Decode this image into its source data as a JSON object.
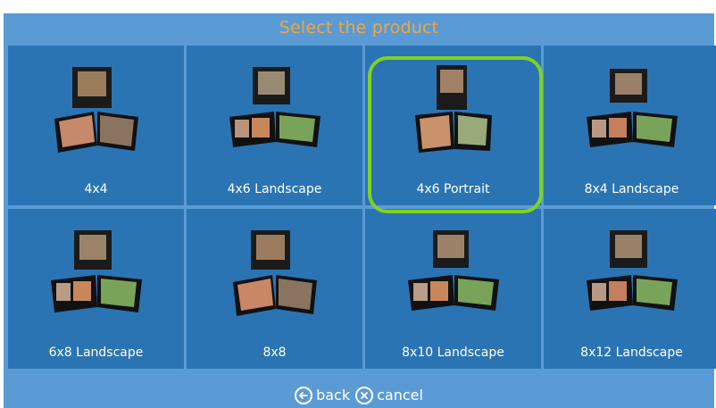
{
  "header": {
    "title": "Select the product"
  },
  "products": [
    {
      "label": "4x4"
    },
    {
      "label": "4x6 Landscape"
    },
    {
      "label": "4x6 Portrait",
      "selected": true
    },
    {
      "label": "8x4 Landscape"
    },
    {
      "label": "6x8 Landscape"
    },
    {
      "label": "8x8"
    },
    {
      "label": "8x10 Landscape"
    },
    {
      "label": "8x12 Landscape"
    }
  ],
  "footer": {
    "back_label": "back",
    "cancel_label": "cancel"
  },
  "colors": {
    "background": "#5a9bd5",
    "tile": "#2a74b4",
    "title": "#f3a53c",
    "selection": "#7ed321"
  },
  "icons": {
    "back": "arrow-left-circle-icon",
    "cancel": "x-circle-icon"
  }
}
